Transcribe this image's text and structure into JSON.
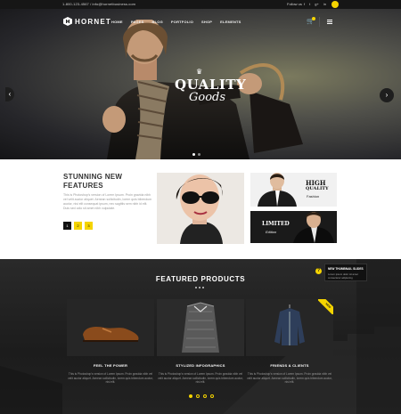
{
  "topbar": {
    "contact": "1-800-123-4567 / info@hornetbusiness.com",
    "follow_label": "Follow us",
    "socials": [
      "f",
      "t",
      "g+",
      "in"
    ]
  },
  "header": {
    "logo": "HORNET",
    "menu": [
      "HOME",
      "PAGES",
      "BLOG",
      "PORTFOLIO",
      "SHOP",
      "ELEMENTS"
    ]
  },
  "hero": {
    "line1": "QUALITY",
    "line2": "Goods",
    "crown": "♛",
    "prev": "‹",
    "next": "›"
  },
  "features": {
    "title_line1": "STUNNING NEW",
    "title_line2": "FEATURES",
    "text": "This is Photoshop's version of Lorem Ipsum. Proin gravida nibh vel velit auctor aliquet. Aenean sollicitudin, lorem quis bibendum auctor, nisi elit consequat ipsum, nec sagittis sem nibh id elit. Duis sed odio sit amet nibh vulputate.",
    "pager": [
      "1",
      "2",
      "3"
    ],
    "hq_line1": "HIGH",
    "hq_line2": "QUALITY",
    "hq_sub": "Fashion",
    "ltd_line1": "LIMITED",
    "ltd_line2": "Edition"
  },
  "products": {
    "title": "FEATURED PRODUCTS",
    "ribbon": "NEW",
    "help": "?",
    "tooltip_title": "NEW THUMBNAIL SLIDES",
    "tooltip_text": "Lorem ipsum dolor sit amet consectetur adipiscing",
    "cards": [
      {
        "label": "FEEL THE POWER",
        "text": "This is Photoshop's version of Lorem Ipsum. Proin gravida nibh vel velit auctor aliquet. Aenean sollicitudin, lorem quis bibendum auctor, nisi elit."
      },
      {
        "label": "STYLIZED INFOGRAPHICS",
        "text": "This is Photoshop's version of Lorem Ipsum. Proin gravida nibh vel velit auctor aliquet. Aenean sollicitudin, lorem quis bibendum auctor, nisi elit."
      },
      {
        "label": "FRIENDS & CLIENTS",
        "text": "This is Photoshop's version of Lorem Ipsum. Proin gravida nibh vel velit auctor aliquet. Aenean sollicitudin, lorem quis bibendum auctor, nisi elit."
      }
    ]
  },
  "colors": {
    "accent": "#f5d400",
    "dark": "#1c1c1c"
  }
}
